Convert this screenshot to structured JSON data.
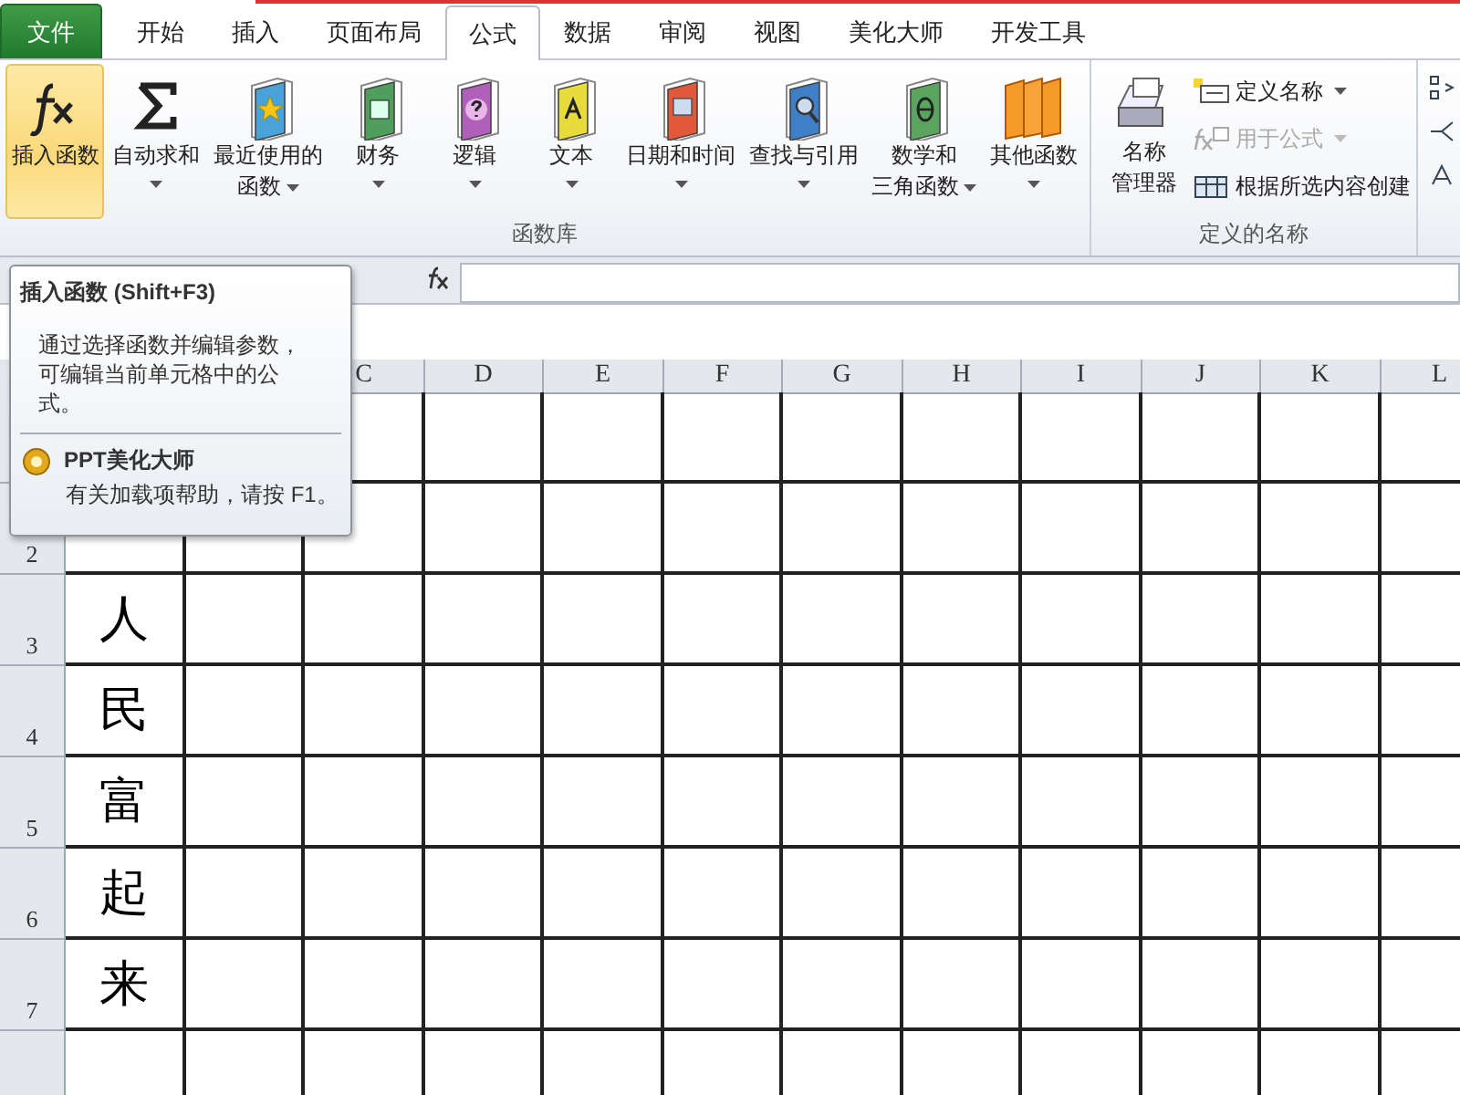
{
  "tabs": [
    {
      "label": "文件",
      "kind": "file",
      "selected": false
    },
    {
      "label": "开始",
      "kind": "normal",
      "selected": false
    },
    {
      "label": "插入",
      "kind": "normal",
      "selected": false
    },
    {
      "label": "页面布局",
      "kind": "normal",
      "selected": false
    },
    {
      "label": "公式",
      "kind": "normal",
      "selected": true
    },
    {
      "label": "数据",
      "kind": "normal",
      "selected": false
    },
    {
      "label": "审阅",
      "kind": "normal",
      "selected": false
    },
    {
      "label": "视图",
      "kind": "normal",
      "selected": false
    },
    {
      "label": "美化大师",
      "kind": "normal",
      "selected": false
    },
    {
      "label": "开发工具",
      "kind": "normal",
      "selected": false
    }
  ],
  "function_library": {
    "label": "函数库",
    "buttons": [
      {
        "kind": "fx",
        "lines": [
          "插入函数"
        ],
        "dropdown": false,
        "selected": true
      },
      {
        "kind": "sum",
        "lines": [
          "自动求和"
        ],
        "dropdown": true,
        "selected": false
      },
      {
        "kind": "book-star",
        "lines": [
          "最近使用的",
          "函数"
        ],
        "dropdown": true,
        "selected": false
      },
      {
        "kind": "book-money",
        "lines": [
          "财务"
        ],
        "dropdown": true,
        "selected": false
      },
      {
        "kind": "book-question",
        "lines": [
          "逻辑"
        ],
        "dropdown": true,
        "selected": false
      },
      {
        "kind": "book-a",
        "lines": [
          "文本"
        ],
        "dropdown": true,
        "selected": false
      },
      {
        "kind": "book-calendar",
        "lines": [
          "日期和时间"
        ],
        "dropdown": true,
        "selected": false
      },
      {
        "kind": "book-search",
        "lines": [
          "查找与引用"
        ],
        "dropdown": true,
        "selected": false
      },
      {
        "kind": "book-theta",
        "lines": [
          "数学和",
          "三角函数"
        ],
        "dropdown": true,
        "selected": false
      },
      {
        "kind": "books",
        "lines": [
          "其他函数"
        ],
        "dropdown": true,
        "selected": false
      }
    ]
  },
  "defined_names": {
    "label": "定义的名称",
    "manager": {
      "lines": [
        "名称",
        "管理器"
      ]
    },
    "items": [
      {
        "kind": "define",
        "label": "定义名称",
        "dropdown": true,
        "disabled": false
      },
      {
        "kind": "formula",
        "label": "用于公式",
        "dropdown": true,
        "disabled": true
      },
      {
        "kind": "create",
        "label": "根据所选内容创建",
        "dropdown": false,
        "disabled": false
      }
    ]
  },
  "tooltip": {
    "title": "插入函数 (Shift+F3)",
    "description": "通过选择函数并编辑参数，可编辑当前单元格中的公式。",
    "addin": "PPT美化大师",
    "help": "有关加载项帮助，请按 F1。"
  },
  "columns": [
    "C",
    "D",
    "E",
    "F",
    "G",
    "H",
    "I",
    "J",
    "K",
    "L"
  ],
  "rows": [
    {
      "header": "2"
    },
    {
      "header": "3",
      "value": "人"
    },
    {
      "header": "4",
      "value": "民"
    },
    {
      "header": "5",
      "value": "富"
    },
    {
      "header": "6",
      "value": "起"
    },
    {
      "header": "7",
      "value": "来"
    }
  ]
}
